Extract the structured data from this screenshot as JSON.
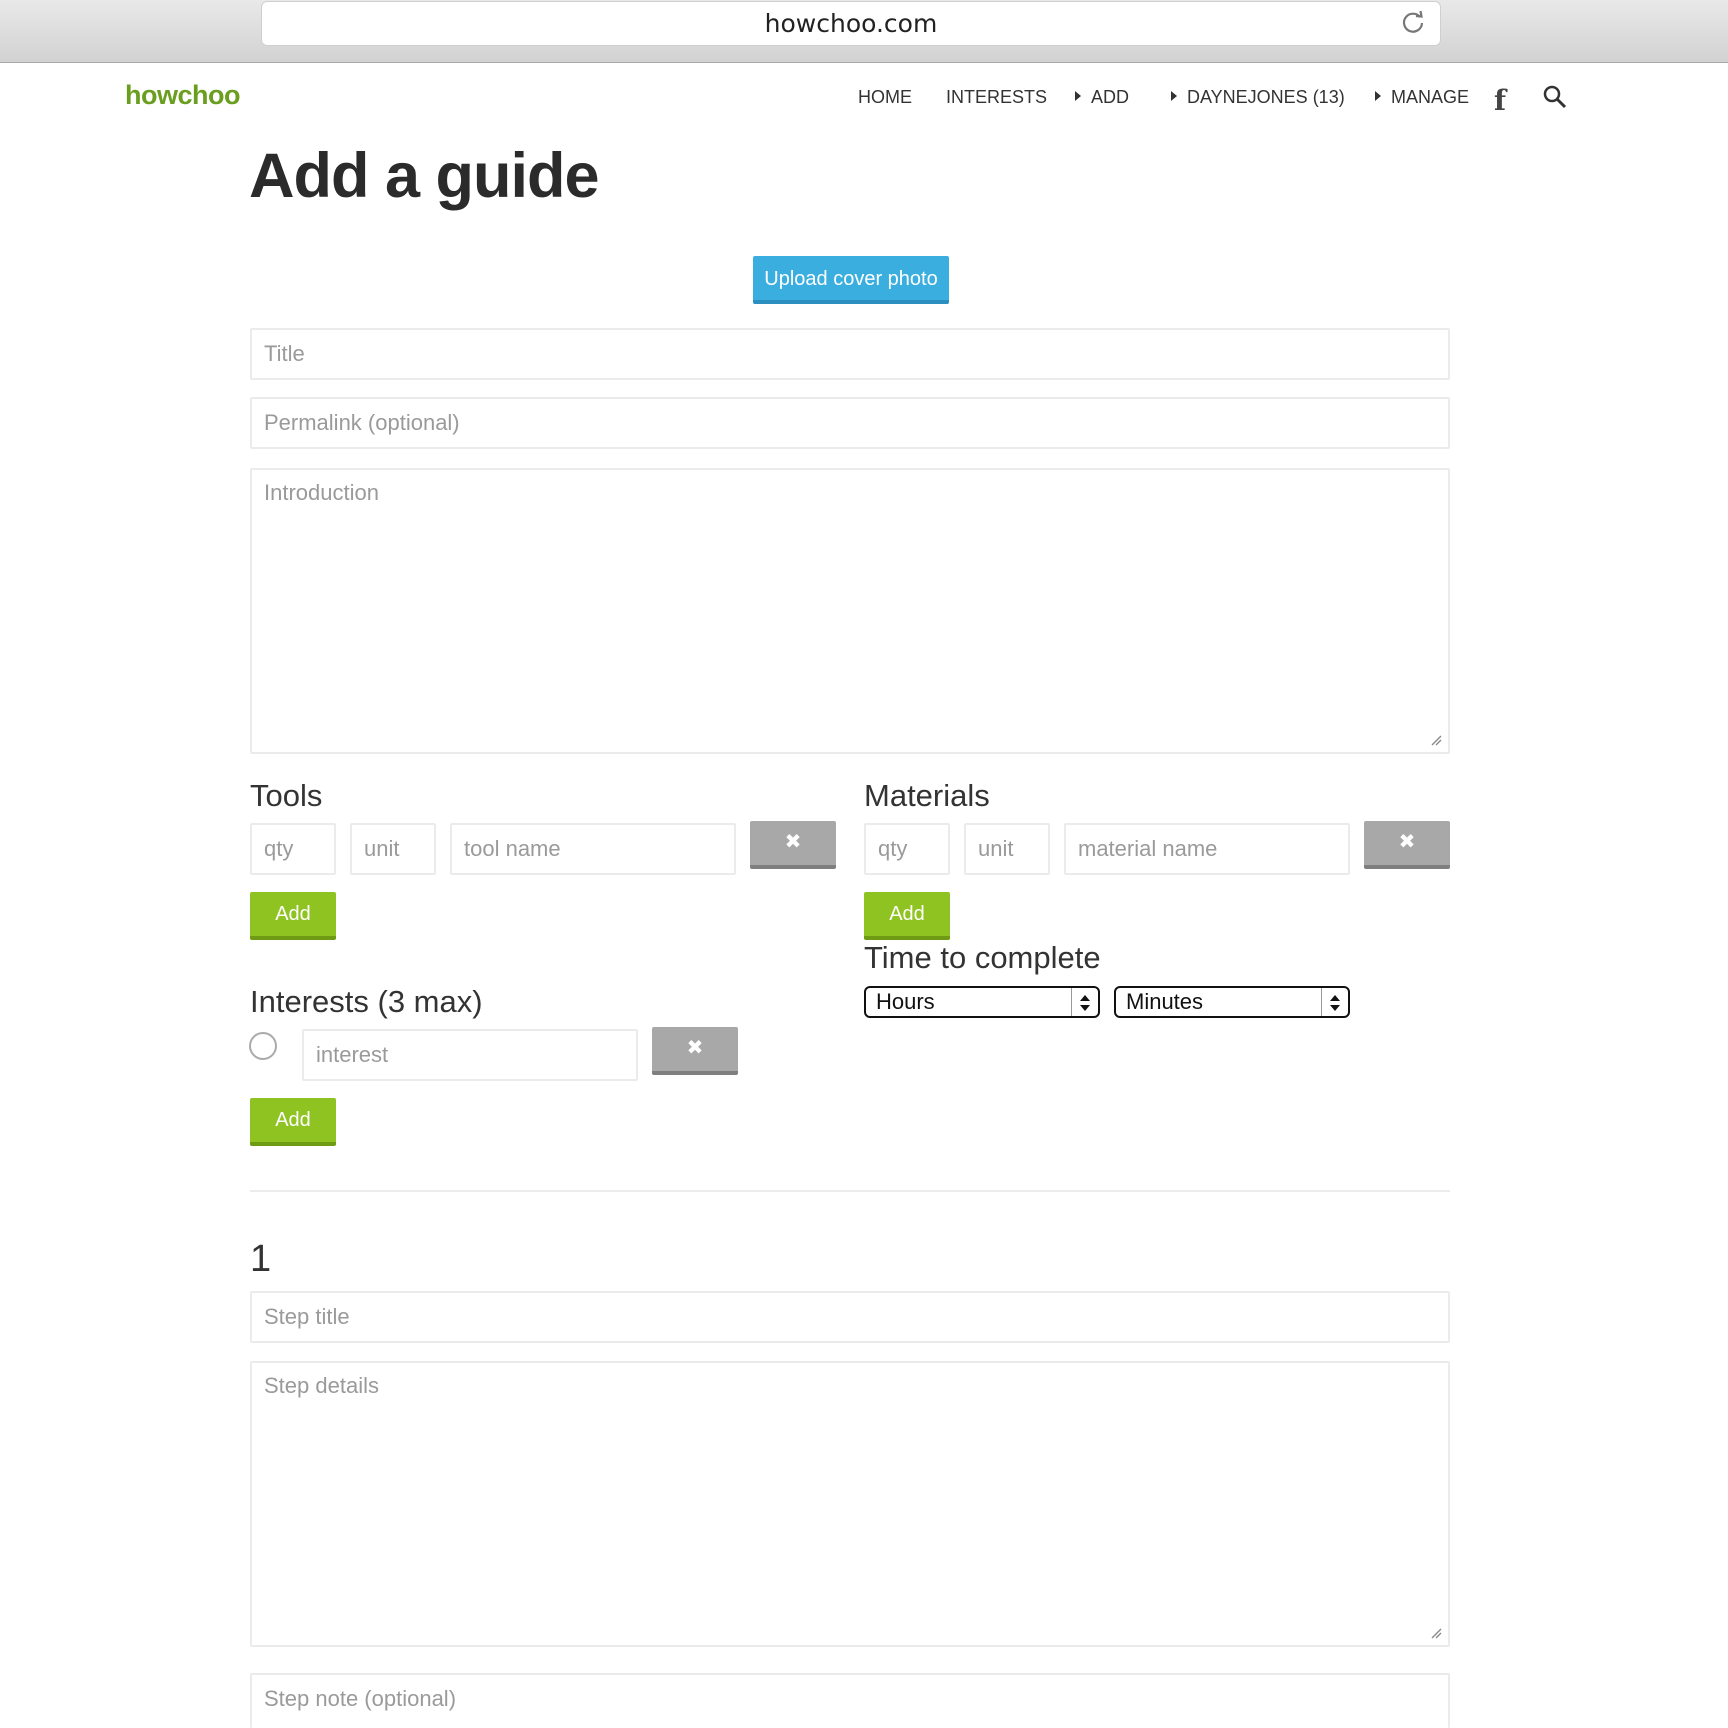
{
  "browser": {
    "url": "howchoo.com"
  },
  "nav": {
    "logo": "howchoo",
    "items": [
      "HOME",
      "INTERESTS",
      "ADD",
      "DAYNEJONES (13)",
      "MANAGE"
    ]
  },
  "page": {
    "title": "Add a guide",
    "upload_button": "Upload cover photo",
    "title_placeholder": "Title",
    "permalink_placeholder": "Permalink (optional)",
    "intro_placeholder": "Introduction"
  },
  "tools": {
    "heading": "Tools",
    "qty_placeholder": "qty",
    "unit_placeholder": "unit",
    "name_placeholder": "tool name",
    "remove_label": "✖",
    "add_label": "Add"
  },
  "materials": {
    "heading": "Materials",
    "qty_placeholder": "qty",
    "unit_placeholder": "unit",
    "name_placeholder": "material name",
    "remove_label": "✖",
    "add_label": "Add"
  },
  "time": {
    "heading": "Time to complete",
    "hours": "Hours",
    "minutes": "Minutes"
  },
  "interests": {
    "heading": "Interests (3 max)",
    "placeholder": "interest",
    "remove_label": "✖",
    "add_label": "Add"
  },
  "step": {
    "number": "1",
    "title_placeholder": "Step title",
    "details_placeholder": "Step details",
    "note_placeholder": "Step note (optional)"
  },
  "colors": {
    "brand_green": "#6a9e1f",
    "upload_blue": "#3aaedf",
    "add_green": "#8ec321",
    "remove_gray": "#a8a8a8"
  },
  "icons": [
    "reload-icon",
    "facebook-icon",
    "search-icon",
    "close-icon",
    "resize-handle-icon",
    "select-arrows-icon"
  ]
}
